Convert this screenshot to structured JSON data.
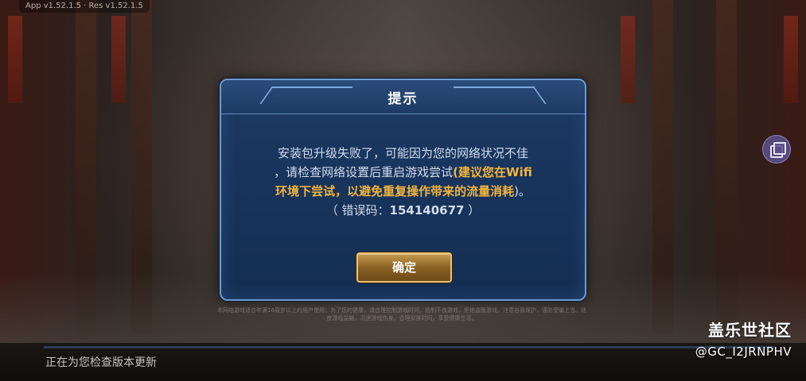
{
  "version_label": "App v1.52.1.5 · Res v1.52.1.5",
  "dialog": {
    "title": "提示",
    "message_line1": "安装包升级失败了，可能因为您的网络状况不佳",
    "message_line2_normal": "，请检查网络设置后重启游戏尝试",
    "message_line2_highlight": "(建议您在Wifi",
    "message_line3_highlight": "环境下尝试，以避免重复操作带来的流量消耗",
    "message_line3_normal": ")。",
    "error_prefix": "（ 错误码：",
    "error_code": "154140677",
    "error_suffix": " ）",
    "confirm_label": "确定"
  },
  "footer_notice": "本网络游戏适合年满16周岁以上的用户使用；为了您的健康，请合理控制游戏时间。抵制不良游戏，拒绝盗版游戏。注意自我保护，谨防受骗上当。适度游戏益脑，沉迷游戏伤身。合理安排时间，享受健康生活。",
  "status": {
    "text": "正在为您检查版本更新",
    "progress": 0
  },
  "watermark": {
    "title": "盖乐世社区",
    "user": "@GC_I2JRNPHV"
  },
  "colors": {
    "highlight": "#f3b43a",
    "dialog_bg": "#18355d",
    "button_gold": "#c79a4f"
  }
}
